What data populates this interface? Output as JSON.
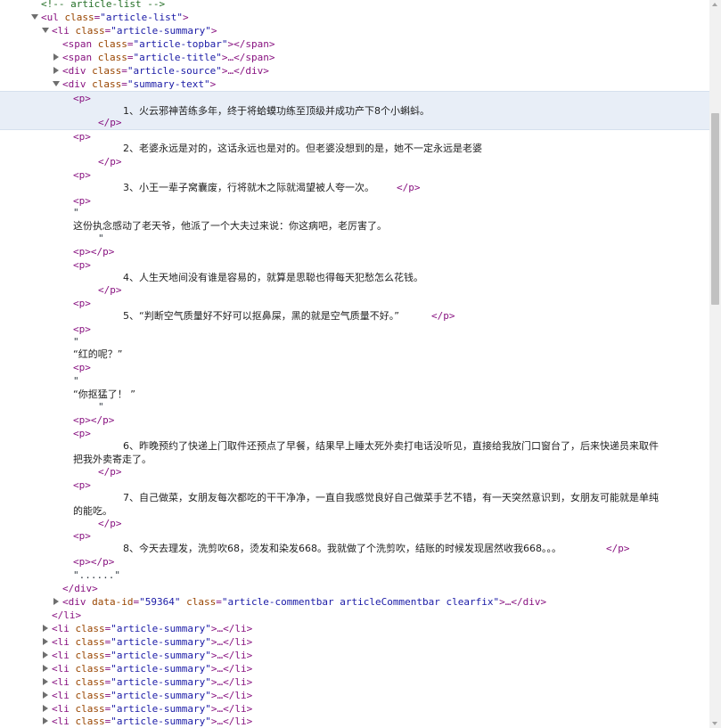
{
  "comment": "<!-- article-list -->",
  "nodes": {
    "ul_open": "<ul class=\"article-list\">",
    "li_open": "<li class=\"article-summary\">",
    "topbar": "<span class=\"article-topbar\"></span>",
    "title": "<span class=\"article-title\">…</span>",
    "source": "<div class=\"article-source\">…</div>",
    "summary_open": "<div class=\"summary-text\">",
    "p_open": "<p>",
    "p_close": "</p>",
    "p_empty": "<p></p>",
    "quote": "\"",
    "ellipsis": "\"......\"",
    "div_close": "</div>",
    "commentbar": "<div data-id=\"59364\" class=\"article-commentbar articleCommentbar clearfix\">…</div>",
    "li_close": "</li>",
    "li_collapsed": "<li class=\"article-summary\">…</li>"
  },
  "paragraphs": {
    "p1": "1、火云邪神苦练多年，终于将蛤蟆功练至顶级并成功产下8个小蝌蚪。",
    "p2": "2、老婆永远是对的，这话永远也是对的。但老婆没想到的是，她不一定永远是老婆",
    "p3": "3、小王一辈子窝囊废，行将就木之际就渴望被人夸一次。",
    "p3b": "这份执念感动了老天爷，他派了一个大夫过来说：你这病吧，老厉害了。",
    "p4": "4、人生天地间没有谁是容易的，就算是思聪也得每天犯愁怎么花钱。",
    "p5": "5、“判断空气质量好不好可以抠鼻屎，黑的就是空气质量不好。”",
    "p5b": "“红的呢？”",
    "p5c": "“你抠猛了！ ”",
    "p6a": "6、昨晚预约了快递上门取件还预点了早餐，结果早上睡太死外卖打电话没听见，直接给我放门口窗台了，后来快递员来取件",
    "p6b": "把我外卖寄走了。",
    "p7a": "7、自己做菜，女朋友每次都吃的干干净净，一直自我感觉良好自己做菜手艺不错，有一天突然意识到，女朋友可能就是单纯",
    "p7b": "的能吃。",
    "p8": "8、今天去理发，洗剪吹68，烫发和染发668。我就做了个洗剪吹，结账的时候发现居然收我668。。。"
  },
  "colors": {
    "tag": "#881280",
    "attr_name": "#994500",
    "attr_value": "#1a1aa6",
    "comment": "#236e25",
    "selection": "#e8eef7",
    "scroll_thumb": "#c1c1c1"
  },
  "icons": {
    "expanded": "triangle-down",
    "collapsed": "triangle-right"
  }
}
